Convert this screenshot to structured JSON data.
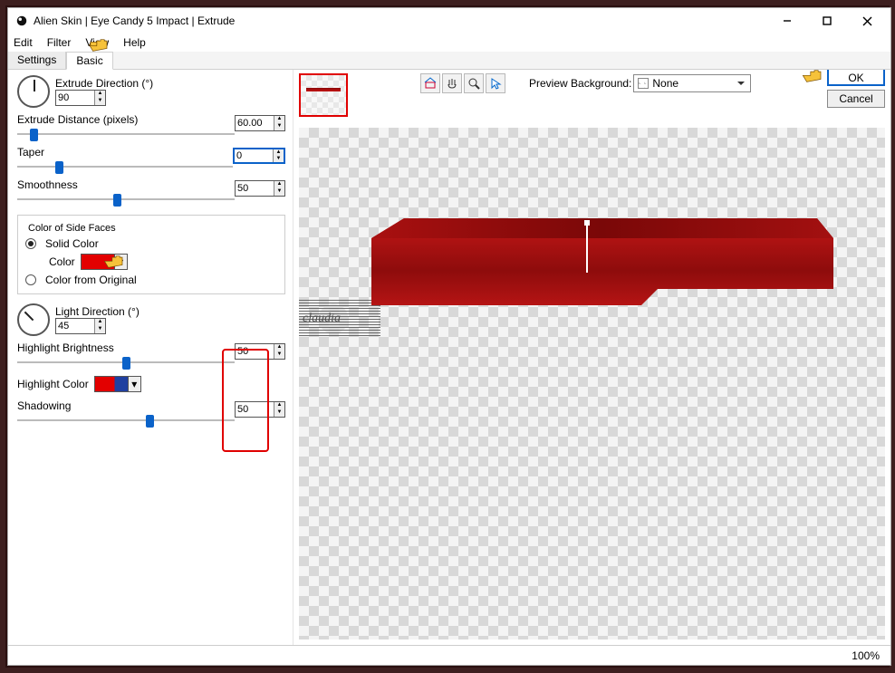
{
  "window": {
    "title": "Alien Skin | Eye Candy 5 Impact | Extrude"
  },
  "menu": {
    "edit": "Edit",
    "filter": "Filter",
    "view": "View",
    "help": "Help"
  },
  "tabs": {
    "settings": "Settings",
    "basic": "Basic"
  },
  "buttons": {
    "ok": "OK",
    "cancel": "Cancel"
  },
  "preview": {
    "bg_label": "Preview Background:",
    "bg_value": "None"
  },
  "status": {
    "zoom": "100%"
  },
  "panel": {
    "extrude_dir_label": "Extrude Direction (°)",
    "extrude_dir_value": "90",
    "extrude_dist_label": "Extrude Distance (pixels)",
    "extrude_dist_value": "60.00",
    "taper_label": "Taper",
    "taper_value": "0",
    "smooth_label": "Smoothness",
    "smooth_value": "50",
    "side_faces_legend": "Color of Side Faces",
    "solid_color_label": "Solid Color",
    "color_label": "Color",
    "color_from_orig_label": "Color from Original",
    "light_dir_label": "Light Direction (°)",
    "light_dir_value": "45",
    "hl_bright_label": "Highlight Brightness",
    "hl_bright_value": "50",
    "hl_color_label": "Highlight Color",
    "shadowing_label": "Shadowing",
    "shadowing_value": "50"
  },
  "colors": {
    "side_face": "#e30000",
    "highlight": "#e30000"
  },
  "watermark": "claudia"
}
